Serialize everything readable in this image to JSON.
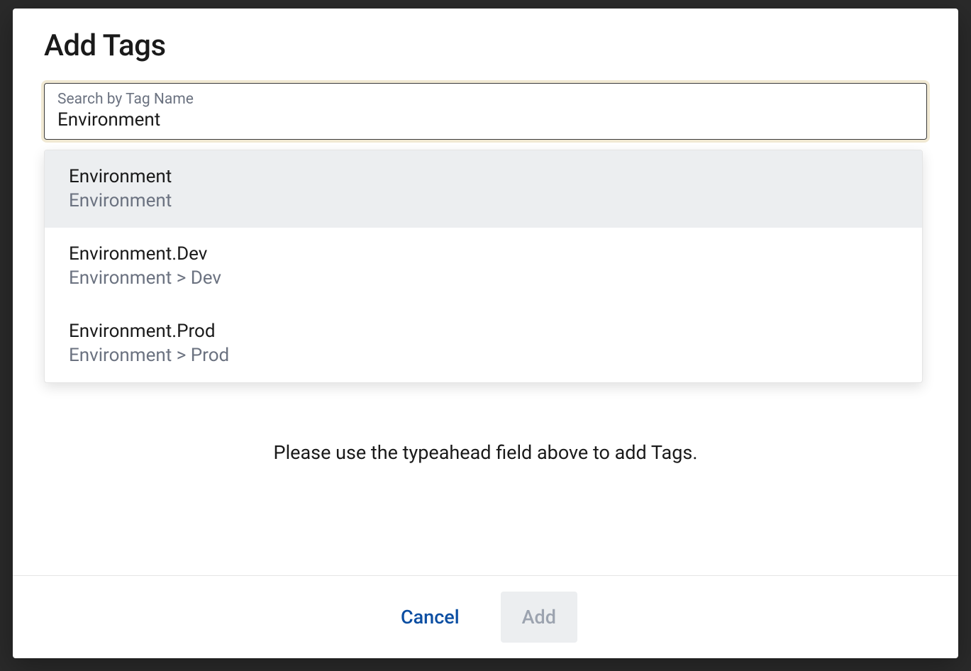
{
  "modal": {
    "title": "Add Tags",
    "search": {
      "label": "Search by Tag Name",
      "value": "Environment"
    },
    "dropdown": {
      "items": [
        {
          "title": "Environment",
          "path": "Environment",
          "highlighted": true
        },
        {
          "title": "Environment.Dev",
          "path": "Environment > Dev",
          "highlighted": false
        },
        {
          "title": "Environment.Prod",
          "path": "Environment > Prod",
          "highlighted": false
        }
      ]
    },
    "helper": "Please use the typeahead field above to add Tags.",
    "footer": {
      "cancel": "Cancel",
      "add": "Add"
    }
  }
}
